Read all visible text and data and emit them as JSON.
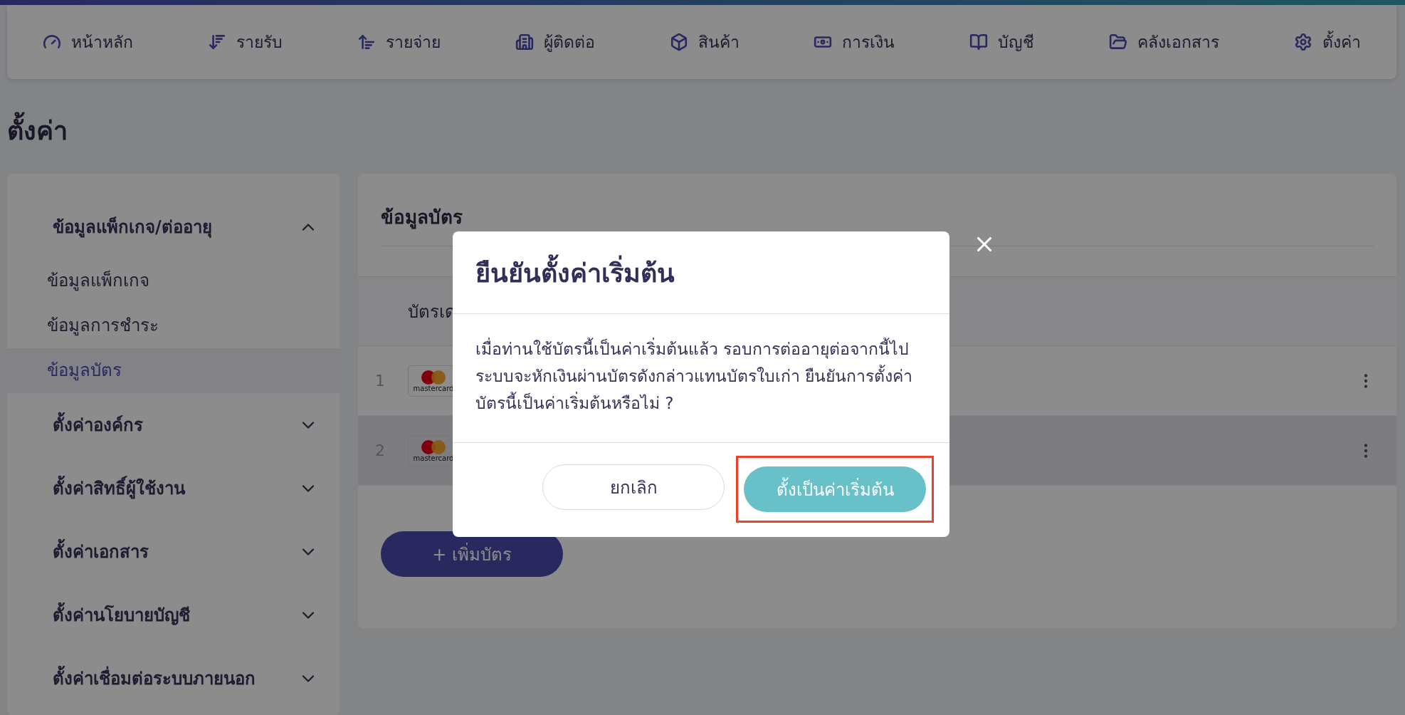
{
  "top_nav": [
    {
      "label": "หน้าหลัก",
      "kind": "dashboard"
    },
    {
      "label": "รายรับ",
      "kind": "income"
    },
    {
      "label": "รายจ่าย",
      "kind": "expense"
    },
    {
      "label": "ผู้ติดต่อ",
      "kind": "contacts"
    },
    {
      "label": "สินค้า",
      "kind": "products"
    },
    {
      "label": "การเงิน",
      "kind": "finance"
    },
    {
      "label": "บัญชี",
      "kind": "accounting"
    },
    {
      "label": "คลังเอกสาร",
      "kind": "documents"
    },
    {
      "label": "ตั้งค่า",
      "kind": "settings"
    }
  ],
  "page_title": "ตั้งค่า",
  "sidebar": [
    {
      "label": "ข้อมูลแพ็กเกจ/ต่ออายุ",
      "expanded": true,
      "children": [
        {
          "label": "ข้อมูลแพ็กเกจ",
          "selected": false
        },
        {
          "label": "ข้อมูลการชำระ",
          "selected": false
        },
        {
          "label": "ข้อมูลบัตร",
          "selected": true
        }
      ]
    },
    {
      "label": "ตั้งค่าองค์กร",
      "expanded": false
    },
    {
      "label": "ตั้งค่าสิทธิ์ผู้ใช้งาน",
      "expanded": false
    },
    {
      "label": "ตั้งค่าเอกสาร",
      "expanded": false
    },
    {
      "label": "ตั้งค่านโยบายบัญชี",
      "expanded": false
    },
    {
      "label": "ตั้งค่าเชื่อมต่อระบบภายนอก",
      "expanded": false
    }
  ],
  "cards_panel": {
    "title": "ข้อมูลบัตร",
    "column_1": "บัตรเด",
    "rows": [
      {
        "index": "1",
        "brand": "mastercard",
        "selected": false
      },
      {
        "index": "2",
        "brand": "mastercard",
        "selected": true
      }
    ],
    "add_button": "+ เพิ่มบัตร"
  },
  "dialog": {
    "title": "ยืนยันตั้งค่าเริ่มต้น",
    "message": "เมื่อท่านใช้บัตรนี้เป็นค่าเริ่มต้นแล้ว รอบการต่ออายุต่อจากนี้ไป ระบบจะหักเงินผ่านบัตรดังกล่าวแทนบัตรใบเก่า ยืนยันการตั้งค่าบัตรนี้เป็นค่าเริ่มต้นหรือไม่ ?",
    "cancel": "ยกเลิก",
    "confirm": "ตั้งเป็นค่าเริ่มต้น",
    "confirm_highlighted": true
  }
}
